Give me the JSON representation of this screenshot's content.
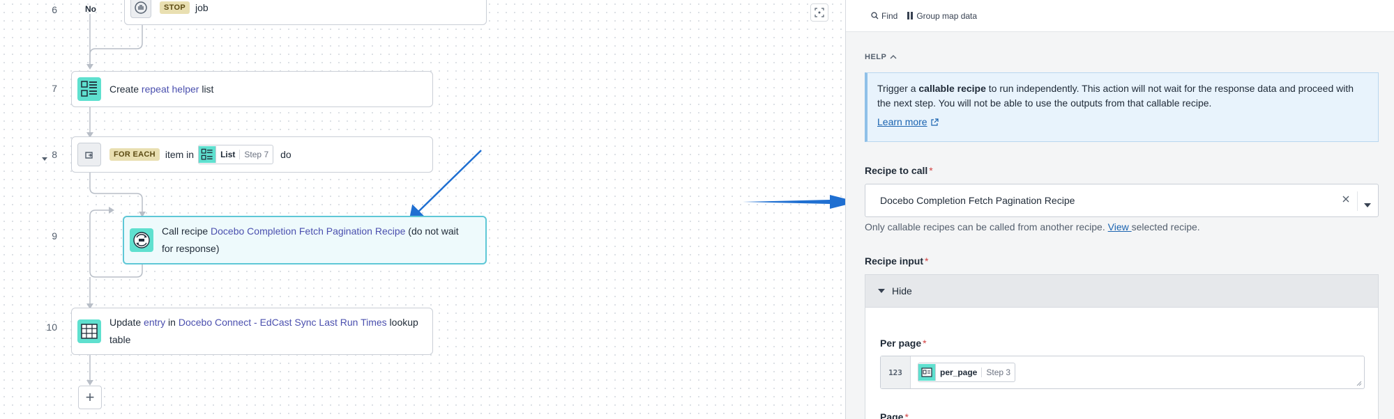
{
  "canvas": {
    "steps": [
      {
        "num": "6",
        "no_label": "No",
        "keyword": "STOP",
        "text": "job"
      },
      {
        "num": "7",
        "pre": "Create ",
        "link": "repeat helper",
        "post": " list"
      },
      {
        "num": "8",
        "keyword": "FOR EACH",
        "pre": "item in",
        "pill_name": "List",
        "pill_step": "Step 7",
        "post": "do"
      },
      {
        "num": "9",
        "pre": "Call recipe ",
        "link": "Docebo Completion Fetch Pagination Recipe",
        "post": " (do not wait",
        "line2": "for response)"
      },
      {
        "num": "10",
        "pre": "Update ",
        "link1": "entry",
        "mid": " in ",
        "link2": "Docebo Connect - EdCast Sync Last Run Times",
        "post": " lookup",
        "line2": "table"
      }
    ],
    "add_button": "+"
  },
  "panel": {
    "toolbar": {
      "find": "Find",
      "group_map": "Group map data"
    },
    "help": {
      "heading": "HELP",
      "text_pre": "Trigger a ",
      "text_bold": "callable recipe",
      "text_post": " to run independently. This action will not wait for the response data and proceed with the next step. You will not be able to use the outputs from that callable recipe.",
      "learn_more": "Learn more"
    },
    "recipe_to_call": {
      "label": "Recipe to call",
      "required": "*",
      "value": "Docebo Completion Fetch Pagination Recipe",
      "hint_pre": "Only callable recipes can be called from another recipe. ",
      "hint_link": "View ",
      "hint_post": "selected recipe."
    },
    "recipe_input": {
      "label": "Recipe input",
      "required": "*",
      "toggle": "Hide",
      "per_page": {
        "label": "Per page",
        "required": "*",
        "type_badge": "123",
        "pill_name": "per_page",
        "pill_step": "Step 3"
      },
      "page": {
        "label": "Page",
        "required": "*"
      }
    }
  },
  "colors": {
    "accent": "#5fe0cf",
    "link": "#4a4fae",
    "arrow": "#1f6fd1",
    "selected_border": "#5ec7d6"
  }
}
